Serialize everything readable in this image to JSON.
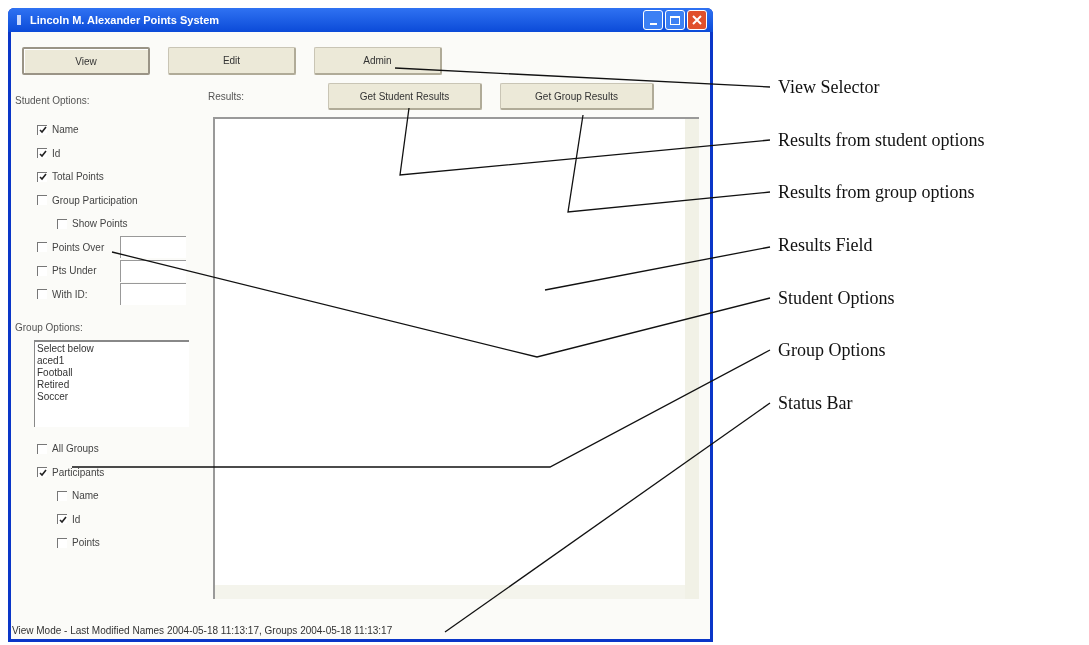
{
  "window": {
    "title": "Lincoln M. Alexander Points System"
  },
  "view_buttons": [
    {
      "label": "View",
      "selected": true
    },
    {
      "label": "Edit",
      "selected": false
    },
    {
      "label": "Admin",
      "selected": false
    }
  ],
  "student_options": {
    "label": "Student Options:",
    "items": [
      {
        "kind": "checkbox",
        "label": "Name",
        "checked": true
      },
      {
        "kind": "checkbox",
        "label": "Id",
        "checked": true
      },
      {
        "kind": "checkbox",
        "label": "Total Points",
        "checked": true
      },
      {
        "kind": "checkbox",
        "label": "Group Participation",
        "checked": false,
        "children": [
          {
            "label": "Show Points",
            "checked": false
          }
        ]
      },
      {
        "kind": "checkbox_field",
        "label": "Points Over",
        "checked": false
      },
      {
        "kind": "checkbox_field",
        "label": "Pts Under",
        "checked": false
      },
      {
        "kind": "checkbox_field",
        "label": "With ID:",
        "checked": false
      }
    ]
  },
  "group_options": {
    "label": "Group Options:",
    "list": [
      "Select below",
      "aced1",
      "Football",
      "Retired",
      "Soccer"
    ],
    "items": [
      {
        "label": "All Groups",
        "checked": false
      },
      {
        "label": "Participants",
        "checked": true,
        "children": [
          {
            "label": "Name",
            "checked": false
          },
          {
            "label": "Id",
            "checked": true
          },
          {
            "label": "Points",
            "checked": false
          }
        ]
      }
    ]
  },
  "results": {
    "label": "Results:",
    "buttons": [
      "Get Student Results",
      "Get Group Results"
    ]
  },
  "status_bar": "View Mode - Last Modified  Names 2004-05-18 11:13:17, Groups 2004-05-18 11:13:17",
  "annotations": [
    "View Selector",
    "Results from student options",
    "Results from group options",
    "Results Field",
    "Student Options",
    "Group Options",
    "Status Bar"
  ]
}
